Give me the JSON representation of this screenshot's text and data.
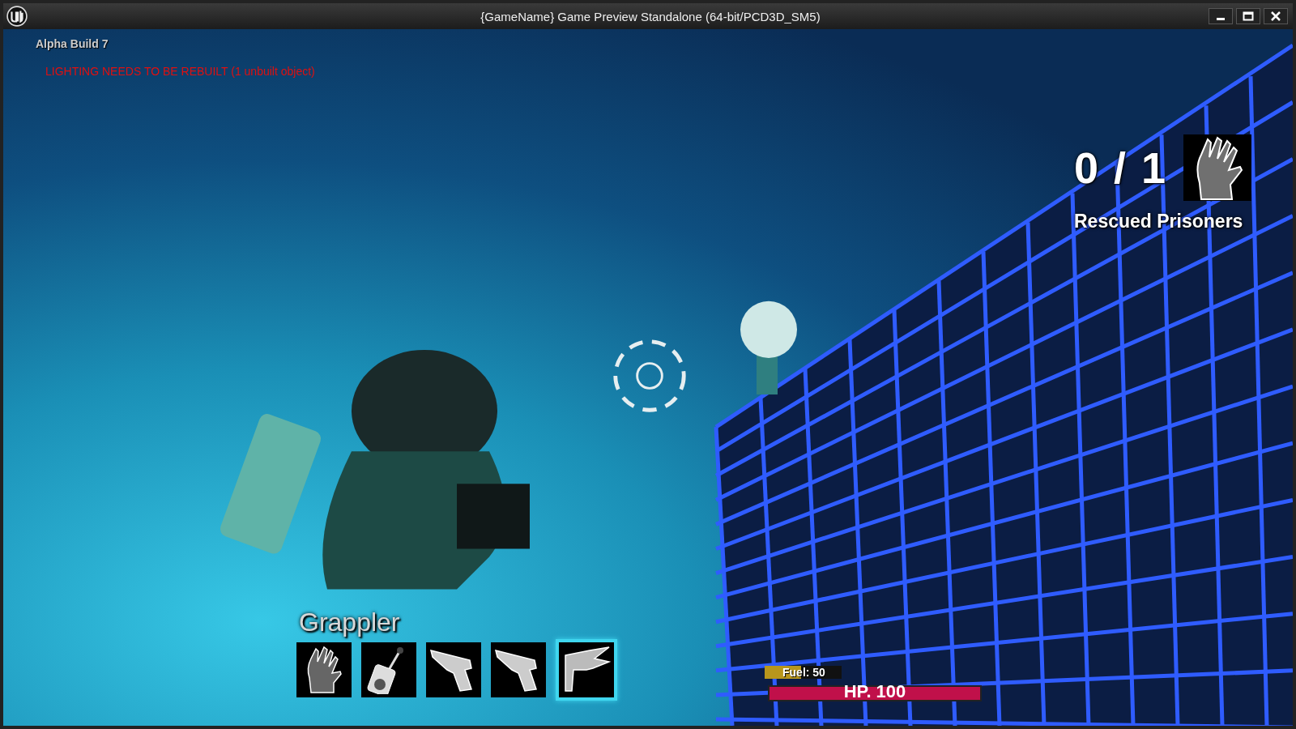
{
  "window": {
    "title": "{GameName} Game Preview Standalone (64-bit/PCD3D_SM5)"
  },
  "build_label": "Alpha Build 7",
  "warning": "LIGHTING NEEDS TO BE REBUILT (1 unbuilt object)",
  "rescued": {
    "count": "0 / 1",
    "label": "Rescued Prisoners"
  },
  "weapon_name": "Grappler",
  "slots": [
    {
      "kind": "hand",
      "selected": false
    },
    {
      "kind": "remote",
      "selected": false
    },
    {
      "kind": "pistol",
      "selected": false
    },
    {
      "kind": "pistol",
      "selected": false
    },
    {
      "kind": "spike",
      "selected": true
    }
  ],
  "fuel": {
    "label": "Fuel: 50",
    "level": 0.47
  },
  "hp": {
    "label": "HP. 100",
    "level": 1
  }
}
